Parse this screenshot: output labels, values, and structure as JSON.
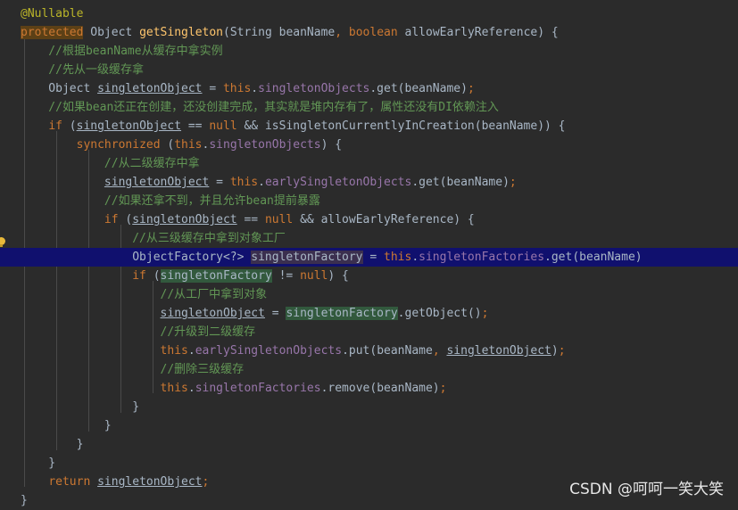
{
  "colors": {
    "background": "#2b2b2b",
    "default_text": "#a9b7c6",
    "keyword": "#cc7832",
    "method": "#ffc66d",
    "field": "#9876aa",
    "comment": "#629755",
    "annotation": "#bbb529",
    "caret_line": "#10106e"
  },
  "gutter": {
    "icon": "lightbulb-icon"
  },
  "lines": [
    {
      "tokens": [
        {
          "t": "@Nullable",
          "k": "annotation"
        }
      ]
    },
    {
      "tokens": [
        {
          "t": "protected",
          "k": "keyword keyword-hl"
        },
        {
          "t": " Object ",
          "k": "plain"
        },
        {
          "t": "getSingleton",
          "k": "method"
        },
        {
          "t": "(String beanName",
          "k": "plain"
        },
        {
          "t": ", ",
          "k": "keyword"
        },
        {
          "t": "boolean",
          "k": "keyword"
        },
        {
          "t": " allowEarlyReference) {",
          "k": "plain"
        }
      ]
    },
    {
      "tokens": [
        {
          "t": "    //根据beanName从缓存中拿实例",
          "k": "comment"
        }
      ]
    },
    {
      "tokens": [
        {
          "t": "    //先从一级缓存拿",
          "k": "comment"
        }
      ]
    },
    {
      "tokens": [
        {
          "t": "    Object ",
          "k": "plain"
        },
        {
          "t": "singletonObject",
          "k": "plain local"
        },
        {
          "t": " = ",
          "k": "plain"
        },
        {
          "t": "this",
          "k": "keyword"
        },
        {
          "t": ".",
          "k": "plain"
        },
        {
          "t": "singletonObjects",
          "k": "field"
        },
        {
          "t": ".get(beanName)",
          "k": "plain"
        },
        {
          "t": ";",
          "k": "keyword"
        }
      ]
    },
    {
      "tokens": [
        {
          "t": "    //如果bean还正在创建，还没创建完成，其实就是堆内存有了，属性还没有DI依赖注入",
          "k": "comment"
        }
      ]
    },
    {
      "tokens": [
        {
          "t": "    ",
          "k": "plain"
        },
        {
          "t": "if",
          "k": "keyword"
        },
        {
          "t": " (",
          "k": "plain"
        },
        {
          "t": "singletonObject",
          "k": "plain local"
        },
        {
          "t": " == ",
          "k": "plain"
        },
        {
          "t": "null",
          "k": "keyword"
        },
        {
          "t": " && isSingletonCurrentlyInCreation(beanName)) {",
          "k": "plain"
        }
      ]
    },
    {
      "tokens": [
        {
          "t": "        ",
          "k": "plain"
        },
        {
          "t": "synchronized",
          "k": "keyword"
        },
        {
          "t": " (",
          "k": "plain"
        },
        {
          "t": "this",
          "k": "keyword"
        },
        {
          "t": ".",
          "k": "plain"
        },
        {
          "t": "singletonObjects",
          "k": "field"
        },
        {
          "t": ") {",
          "k": "plain"
        }
      ]
    },
    {
      "tokens": [
        {
          "t": "            //从二级缓存中拿",
          "k": "comment"
        }
      ]
    },
    {
      "tokens": [
        {
          "t": "            ",
          "k": "plain"
        },
        {
          "t": "singletonObject",
          "k": "plain local"
        },
        {
          "t": " = ",
          "k": "plain"
        },
        {
          "t": "this",
          "k": "keyword"
        },
        {
          "t": ".",
          "k": "plain"
        },
        {
          "t": "earlySingletonObjects",
          "k": "field"
        },
        {
          "t": ".get(beanName)",
          "k": "plain"
        },
        {
          "t": ";",
          "k": "keyword"
        }
      ]
    },
    {
      "tokens": [
        {
          "t": "            //如果还拿不到，并且允许bean提前暴露",
          "k": "comment"
        }
      ]
    },
    {
      "tokens": [
        {
          "t": "            ",
          "k": "plain"
        },
        {
          "t": "if",
          "k": "keyword"
        },
        {
          "t": " (",
          "k": "plain"
        },
        {
          "t": "singletonObject",
          "k": "plain local"
        },
        {
          "t": " == ",
          "k": "plain"
        },
        {
          "t": "null",
          "k": "keyword"
        },
        {
          "t": " && allowEarlyReference) {",
          "k": "plain"
        }
      ]
    },
    {
      "tokens": [
        {
          "t": "                //从三级缓存中拿到对象工厂",
          "k": "comment"
        }
      ]
    },
    {
      "caret": true,
      "tokens": [
        {
          "t": "                ObjectFactory<?> ",
          "k": "plain"
        },
        {
          "t": "singletonFactory",
          "k": "plain hl-purple"
        },
        {
          "t": " = ",
          "k": "plain"
        },
        {
          "t": "this",
          "k": "keyword"
        },
        {
          "t": ".",
          "k": "plain"
        },
        {
          "t": "singletonFactories",
          "k": "field"
        },
        {
          "t": ".get(beanName)",
          "k": "plain"
        }
      ]
    },
    {
      "tokens": [
        {
          "t": "                ",
          "k": "plain"
        },
        {
          "t": "if",
          "k": "keyword"
        },
        {
          "t": " (",
          "k": "plain"
        },
        {
          "t": "singletonFactory",
          "k": "plain hl-green"
        },
        {
          "t": " != ",
          "k": "plain"
        },
        {
          "t": "null",
          "k": "keyword"
        },
        {
          "t": ") {",
          "k": "plain"
        }
      ]
    },
    {
      "tokens": [
        {
          "t": "                    //从工厂中拿到对象",
          "k": "comment"
        }
      ]
    },
    {
      "tokens": [
        {
          "t": "                    ",
          "k": "plain"
        },
        {
          "t": "singletonObject",
          "k": "plain local"
        },
        {
          "t": " = ",
          "k": "plain"
        },
        {
          "t": "singletonFactory",
          "k": "plain hl-green"
        },
        {
          "t": ".getObject()",
          "k": "plain"
        },
        {
          "t": ";",
          "k": "keyword"
        }
      ]
    },
    {
      "tokens": [
        {
          "t": "                    //升级到二级缓存",
          "k": "comment"
        }
      ]
    },
    {
      "tokens": [
        {
          "t": "                    ",
          "k": "plain"
        },
        {
          "t": "this",
          "k": "keyword"
        },
        {
          "t": ".",
          "k": "plain"
        },
        {
          "t": "earlySingletonObjects",
          "k": "field"
        },
        {
          "t": ".put(beanName",
          "k": "plain"
        },
        {
          "t": ", ",
          "k": "keyword"
        },
        {
          "t": "singletonObject",
          "k": "plain local"
        },
        {
          "t": ")",
          "k": "plain"
        },
        {
          "t": ";",
          "k": "keyword"
        }
      ]
    },
    {
      "tokens": [
        {
          "t": "                    //删除三级缓存",
          "k": "comment"
        }
      ]
    },
    {
      "tokens": [
        {
          "t": "                    ",
          "k": "plain"
        },
        {
          "t": "this",
          "k": "keyword"
        },
        {
          "t": ".",
          "k": "plain"
        },
        {
          "t": "singletonFactories",
          "k": "field"
        },
        {
          "t": ".remove(beanName)",
          "k": "plain"
        },
        {
          "t": ";",
          "k": "keyword"
        }
      ]
    },
    {
      "tokens": [
        {
          "t": "                }",
          "k": "plain"
        }
      ]
    },
    {
      "tokens": [
        {
          "t": "            }",
          "k": "plain"
        }
      ]
    },
    {
      "tokens": [
        {
          "t": "        }",
          "k": "plain"
        }
      ]
    },
    {
      "tokens": [
        {
          "t": "    }",
          "k": "plain"
        }
      ]
    },
    {
      "tokens": [
        {
          "t": "    ",
          "k": "plain"
        },
        {
          "t": "return",
          "k": "keyword"
        },
        {
          "t": " ",
          "k": "plain"
        },
        {
          "t": "singletonObject",
          "k": "plain local"
        },
        {
          "t": ";",
          "k": "keyword"
        }
      ]
    },
    {
      "tokens": [
        {
          "t": "}",
          "k": "plain"
        }
      ]
    }
  ],
  "watermark": "CSDN @呵呵一笑大笑"
}
